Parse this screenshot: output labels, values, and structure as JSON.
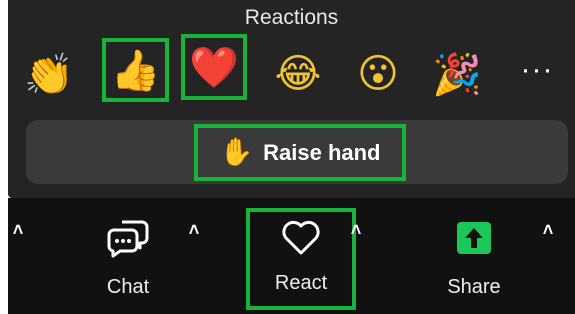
{
  "reactions_panel": {
    "title": "Reactions",
    "emojis": [
      {
        "name": "clapping-hands",
        "glyph": "👏"
      },
      {
        "name": "thumbs-up",
        "glyph": "👍",
        "highlighted": true
      },
      {
        "name": "red-heart",
        "glyph": "❤️",
        "highlighted": true
      },
      {
        "name": "tears-of-joy",
        "glyph": "😂"
      },
      {
        "name": "open-mouth",
        "glyph": "😮"
      },
      {
        "name": "party-popper",
        "glyph": "🎉"
      }
    ],
    "more_label": "···",
    "raise_hand": {
      "icon": "✋",
      "label": "Raise hand",
      "highlighted": true
    }
  },
  "toolbar": {
    "chat": {
      "label": "Chat",
      "icon": "chat-bubbles-icon"
    },
    "react": {
      "label": "React",
      "icon": "heart-outline-icon",
      "highlighted": true
    },
    "share": {
      "label": "Share",
      "icon": "share-arrow-icon"
    },
    "caret_glyph": "˄"
  },
  "colors": {
    "highlight": "#19b33a",
    "share_green": "#1ac859",
    "panel_bg": "#242424",
    "toolbar_bg": "#111111"
  }
}
